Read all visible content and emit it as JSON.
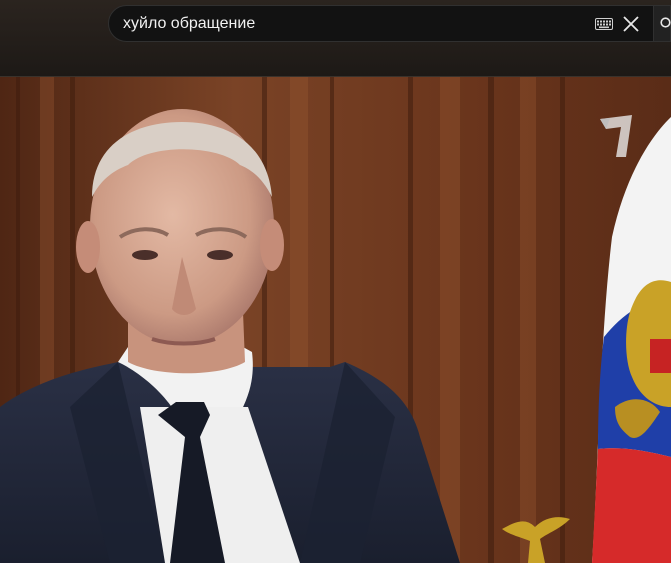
{
  "search": {
    "query": "хуйло обращение",
    "keyboard_icon": "keyboard-icon",
    "clear_icon": "close-icon",
    "search_icon": "search-icon"
  },
  "video": {
    "channel_logo": "channel-one-logo",
    "colors": {
      "wall": "#6e3a1f",
      "suit": "#22283a",
      "shirt": "#f2f2f2",
      "tie": "#161a26",
      "flag_white": "#f3f3f3",
      "flag_blue": "#1f3fa8",
      "flag_red": "#d62a2a",
      "eagle_gold": "#c9a227"
    }
  }
}
